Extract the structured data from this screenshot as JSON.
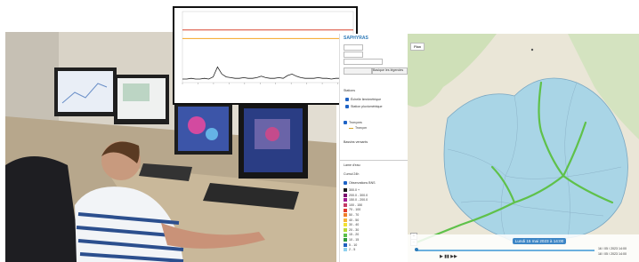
{
  "chart_inset": {
    "chart_data": {
      "type": "line",
      "title": "",
      "xlabel": "",
      "ylabel": "",
      "threshold_lines": [
        {
          "color": "#d8432f",
          "level": 0.74
        },
        {
          "color": "#f5a623",
          "level": 0.62
        }
      ],
      "series": [
        {
          "color": "#222222",
          "values": [
            0.05,
            0.05,
            0.06,
            0.05,
            0.05,
            0.06,
            0.05,
            0.08,
            0.22,
            0.12,
            0.08,
            0.07,
            0.06,
            0.06,
            0.07,
            0.06,
            0.06,
            0.07,
            0.09,
            0.07,
            0.06,
            0.06,
            0.07,
            0.06,
            0.1,
            0.12,
            0.09,
            0.07,
            0.06,
            0.06,
            0.06,
            0.07,
            0.06,
            0.06,
            0.05,
            0.06,
            0.06,
            0.05,
            0.05,
            0.05
          ]
        }
      ]
    }
  },
  "app": {
    "brand": "SAPHYRAS",
    "map_button": "Plan",
    "search_placeholder": "Rechercher",
    "tab_a": "",
    "tab_b": "Basique les légendes",
    "section_stations": "Stations",
    "layer_1": "Échelle limnimétrique",
    "layer_2": "Station pluviométrique",
    "section_troncons": "Tronçons",
    "troncons_item": "Tronçon",
    "layer_watersheds": "Bassins versants",
    "section_lame": "Lame d'eau",
    "section_cumul": "Cumul 24h",
    "section_obs": "Observations BNS",
    "legend": [
      "300.0 +",
      "200.0 - 300.0",
      "150.0 - 200.0",
      "100 - 150",
      "70 - 100",
      "50 - 70",
      "40 - 50",
      "30 - 40",
      "20 - 30",
      "15 - 20",
      "10 - 15",
      "5 - 10",
      "2 - 5"
    ],
    "legend_colors": [
      "#1a1a1a",
      "#7a0d6e",
      "#a21b8f",
      "#c43a66",
      "#e23b2d",
      "#ef7d2a",
      "#f7b63a",
      "#f2e135",
      "#b8d939",
      "#5cbf4a",
      "#2d9a3b",
      "#1f5fbf",
      "#8fd1ef"
    ],
    "timeline_label": "Lundi 15 mai 2023 à 14:00",
    "time_left": "14:00",
    "time_right_1": "16 / 05 / 2023 14:00",
    "time_right_2": "18 / 05 / 2023 14:00",
    "zoom_in": "+",
    "zoom_out": "−",
    "attribution": "Données cartographiques"
  }
}
